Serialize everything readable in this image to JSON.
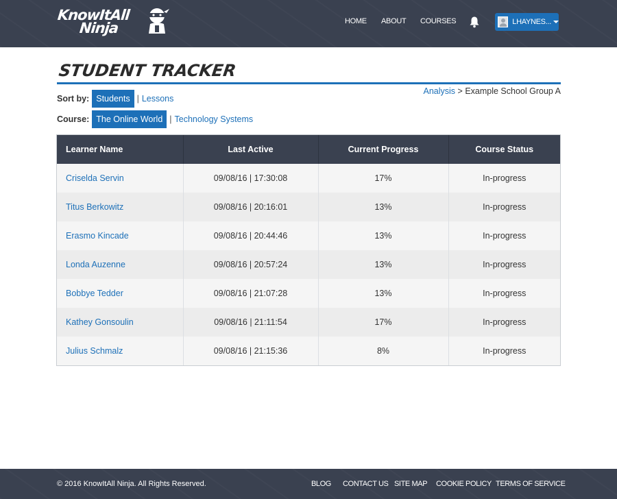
{
  "header": {
    "logo_line1": "KnowItAll",
    "logo_line2": "Ninja",
    "nav": [
      {
        "label": "HOME"
      },
      {
        "label": "ABOUT"
      },
      {
        "label": "COURSES"
      }
    ],
    "user_label": "LHAYNES..."
  },
  "page": {
    "title": "STUDENT TRACKER",
    "breadcrumb_link": "Analysis",
    "breadcrumb_sep": ">",
    "breadcrumb_current": "Example School Group A"
  },
  "sort": {
    "label": "Sort by:",
    "active": "Students",
    "separator": "|",
    "other": "Lessons"
  },
  "course": {
    "label": "Course:",
    "active": "The Online World",
    "separator": "|",
    "other": "Technology Systems"
  },
  "table": {
    "headers": [
      "Learner Name",
      "Last Active",
      "Current Progress",
      "Course Status"
    ],
    "rows": [
      {
        "name": "Criselda Servin",
        "last_active": "09/08/16 | 17:30:08",
        "progress": "17%",
        "status": "In-progress"
      },
      {
        "name": "Titus Berkowitz",
        "last_active": "09/08/16 | 20:16:01",
        "progress": "13%",
        "status": "In-progress"
      },
      {
        "name": "Erasmo Kincade",
        "last_active": "09/08/16 | 20:44:46",
        "progress": "13%",
        "status": "In-progress"
      },
      {
        "name": "Londa Auzenne",
        "last_active": "09/08/16 | 20:57:24",
        "progress": "13%",
        "status": "In-progress"
      },
      {
        "name": "Bobbye Tedder",
        "last_active": "09/08/16 | 21:07:28",
        "progress": "13%",
        "status": "In-progress"
      },
      {
        "name": "Kathey Gonsoulin",
        "last_active": "09/08/16 | 21:11:54",
        "progress": "17%",
        "status": "In-progress"
      },
      {
        "name": "Julius Schmalz",
        "last_active": "09/08/16 | 21:15:36",
        "progress": "8%",
        "status": "In-progress"
      }
    ]
  },
  "footer": {
    "copyright": "© 2016 KnowItAll Ninja. All Rights Reserved.",
    "links": [
      {
        "label": "BLOG"
      },
      {
        "label": "CONTACT US"
      },
      {
        "label": "SITE MAP"
      },
      {
        "label": "COOKIE POLICY"
      },
      {
        "label": "TERMS OF SERVICE"
      }
    ]
  },
  "colors": {
    "header_bg": "#3a4150",
    "accent_blue": "#1d70b8",
    "row_light": "#f5f5f5",
    "row_dark": "#ececec"
  },
  "icons": {
    "bell": "bell-icon",
    "caret": "caret-down-icon",
    "avatar": "avatar-icon",
    "logo": "ninja-mascot-icon"
  }
}
